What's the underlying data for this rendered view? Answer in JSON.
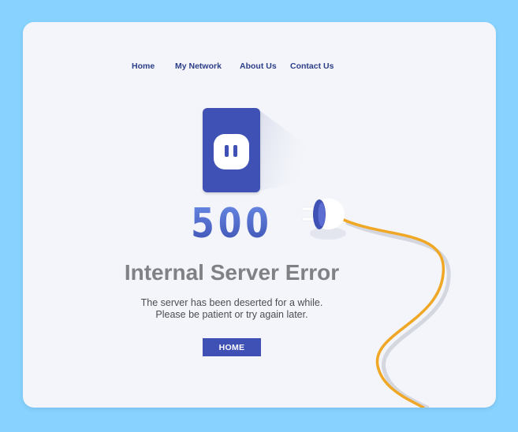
{
  "nav": {
    "items": [
      {
        "label": "Home"
      },
      {
        "label": "My Network"
      },
      {
        "label": "About Us"
      },
      {
        "label": "Contact Us"
      }
    ]
  },
  "error": {
    "code": "500",
    "title": "Internal Server Error",
    "line1": "The server has been deserted for a while.",
    "line2": "Please be patient or try again later."
  },
  "home_button": {
    "label": "HOME"
  },
  "icons": {
    "socket": "power-socket-icon",
    "plug": "power-plug-icon"
  },
  "colors": {
    "background": "#87d2fe",
    "card": "#f3f5fa",
    "primary": "#3f51b5",
    "cable": "#f0a726",
    "title": "#7f8185"
  }
}
